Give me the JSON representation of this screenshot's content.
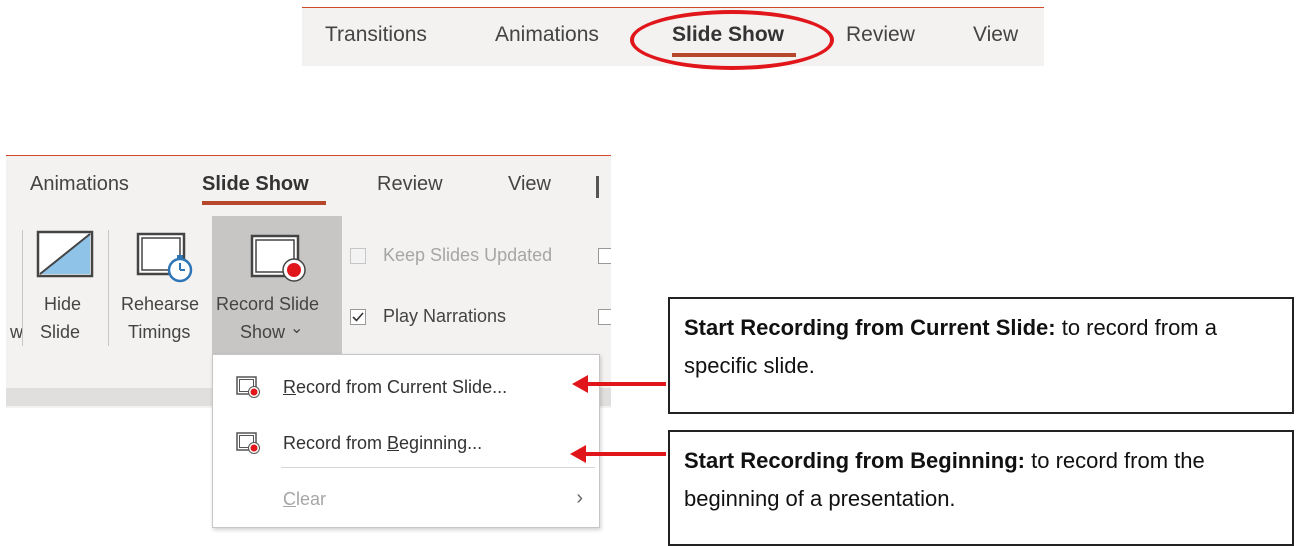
{
  "top_tabs": [
    "Transitions",
    "Animations",
    "Slide Show",
    "Review",
    "View"
  ],
  "ribbon": {
    "tabs": [
      "Animations",
      "Slide Show",
      "Review",
      "View"
    ],
    "edge_text": "w",
    "hide_slide": [
      "Hide",
      "Slide"
    ],
    "rehearse": [
      "Rehearse",
      "Timings"
    ],
    "record": [
      "Record Slide",
      "Show"
    ],
    "record_caret": "⌄",
    "checkboxes": {
      "keep_updated": "Keep Slides Updated",
      "play_narrations": "Play Narrations"
    }
  },
  "menu": {
    "from_current": {
      "underline": "R",
      "rest": "ecord from Current Slide..."
    },
    "from_beginning": {
      "pre": "Record from ",
      "underline": "B",
      "rest": "eginning..."
    },
    "clear": {
      "underline": "C",
      "rest": "lear"
    },
    "chevron": "›"
  },
  "callouts": {
    "current": {
      "bold": "Start Recording from Current Slide:",
      "text": " to record from a specific slide."
    },
    "beginning": {
      "bold": "Start Recording from Beginning:",
      "text": " to record from the beginning of a presentation."
    }
  },
  "colors": {
    "accent": "#b7472a",
    "highlight_red": "#e0161b",
    "ribbon_bg": "#f3f2f1",
    "record_hover": "#c8c6c4"
  }
}
